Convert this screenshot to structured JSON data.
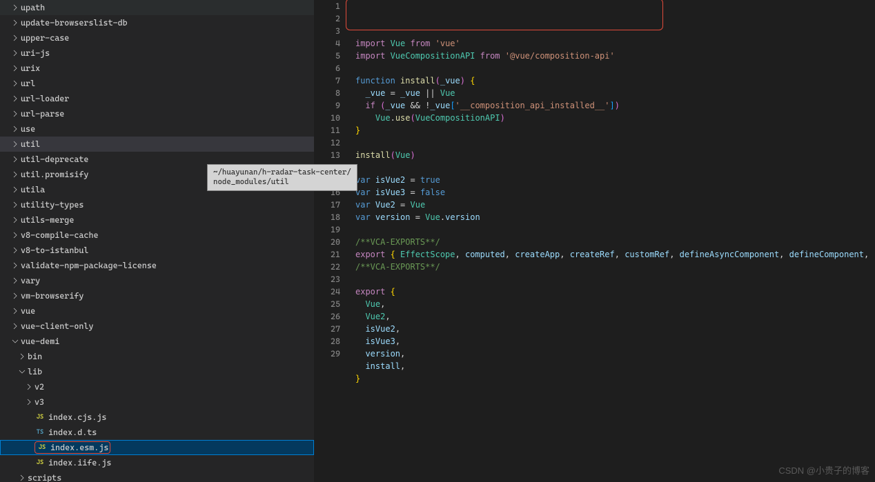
{
  "watermark": "CSDN @小贵子的博客",
  "tooltip": "~/huayunan/h-radar-task-center/\nnode_modules/util",
  "tree": [
    {
      "label": "upath",
      "type": "folder",
      "indent": 1
    },
    {
      "label": "update-browserslist-db",
      "type": "folder",
      "indent": 1
    },
    {
      "label": "upper-case",
      "type": "folder",
      "indent": 1
    },
    {
      "label": "uri-js",
      "type": "folder",
      "indent": 1
    },
    {
      "label": "urix",
      "type": "folder",
      "indent": 1
    },
    {
      "label": "url",
      "type": "folder",
      "indent": 1
    },
    {
      "label": "url-loader",
      "type": "folder",
      "indent": 1
    },
    {
      "label": "url-parse",
      "type": "folder",
      "indent": 1
    },
    {
      "label": "use",
      "type": "folder",
      "indent": 1
    },
    {
      "label": "util",
      "type": "folder",
      "indent": 1,
      "hover": true
    },
    {
      "label": "util-deprecate",
      "type": "folder",
      "indent": 1
    },
    {
      "label": "util.promisify",
      "type": "folder",
      "indent": 1
    },
    {
      "label": "utila",
      "type": "folder",
      "indent": 1
    },
    {
      "label": "utility-types",
      "type": "folder",
      "indent": 1
    },
    {
      "label": "utils-merge",
      "type": "folder",
      "indent": 1
    },
    {
      "label": "v8-compile-cache",
      "type": "folder",
      "indent": 1
    },
    {
      "label": "v8-to-istanbul",
      "type": "folder",
      "indent": 1
    },
    {
      "label": "validate-npm-package-license",
      "type": "folder",
      "indent": 1
    },
    {
      "label": "vary",
      "type": "folder",
      "indent": 1
    },
    {
      "label": "vm-browserify",
      "type": "folder",
      "indent": 1
    },
    {
      "label": "vue",
      "type": "folder",
      "indent": 1
    },
    {
      "label": "vue-client-only",
      "type": "folder",
      "indent": 1
    },
    {
      "label": "vue-demi",
      "type": "folder",
      "indent": 1,
      "expanded": true
    },
    {
      "label": "bin",
      "type": "folder",
      "indent": 2
    },
    {
      "label": "lib",
      "type": "folder",
      "indent": 2,
      "expanded": true
    },
    {
      "label": "v2",
      "type": "folder",
      "indent": 3
    },
    {
      "label": "v3",
      "type": "folder",
      "indent": 3
    },
    {
      "label": "index.cjs.js",
      "type": "file",
      "icon": "JS",
      "indent": 3
    },
    {
      "label": "index.d.ts",
      "type": "file",
      "icon": "TS",
      "indent": 3
    },
    {
      "label": "index.esm.js",
      "type": "file",
      "icon": "JS",
      "indent": 3,
      "selected": true,
      "boxed": true
    },
    {
      "label": "index.iife.js",
      "type": "file",
      "icon": "JS",
      "indent": 3
    },
    {
      "label": "scripts",
      "type": "folder",
      "indent": 2
    }
  ],
  "code": {
    "lines": [
      {
        "n": 1,
        "tokens": [
          [
            "import ",
            "kw"
          ],
          [
            "Vue",
            "cls"
          ],
          [
            " from ",
            "kw"
          ],
          [
            "'vue'",
            "str"
          ]
        ]
      },
      {
        "n": 2,
        "tokens": [
          [
            "import ",
            "kw"
          ],
          [
            "VueCompositionAPI",
            "cls"
          ],
          [
            " from ",
            "kw"
          ],
          [
            "'@vue/composition-api'",
            "str"
          ]
        ]
      },
      {
        "n": 3,
        "tokens": [
          [
            "",
            ""
          ]
        ]
      },
      {
        "n": 4,
        "tokens": [
          [
            "function ",
            "const"
          ],
          [
            "install",
            "fn"
          ],
          [
            "(",
            "paren"
          ],
          [
            "_vue",
            "param"
          ],
          [
            ") ",
            "paren"
          ],
          [
            "{",
            "brace"
          ]
        ]
      },
      {
        "n": 5,
        "tokens": [
          [
            "  ",
            ""
          ],
          [
            "_vue",
            "var"
          ],
          [
            " = ",
            ""
          ],
          [
            "_vue",
            "var"
          ],
          [
            " || ",
            ""
          ],
          [
            "Vue",
            "cls"
          ]
        ]
      },
      {
        "n": 6,
        "tokens": [
          [
            "  ",
            ""
          ],
          [
            "if ",
            "kw"
          ],
          [
            "(",
            "paren"
          ],
          [
            "_vue",
            "var"
          ],
          [
            " && !",
            ""
          ],
          [
            "_vue",
            "var"
          ],
          [
            "[",
            "bracket"
          ],
          [
            "'__composition_api_installed__'",
            "str"
          ],
          [
            "]",
            "bracket"
          ],
          [
            ")",
            "paren"
          ]
        ]
      },
      {
        "n": 7,
        "tokens": [
          [
            "    ",
            ""
          ],
          [
            "Vue",
            "cls"
          ],
          [
            ".",
            ""
          ],
          [
            "use",
            "fn"
          ],
          [
            "(",
            "paren"
          ],
          [
            "VueCompositionAPI",
            "cls"
          ],
          [
            ")",
            "paren"
          ]
        ]
      },
      {
        "n": 8,
        "tokens": [
          [
            "}",
            "brace"
          ]
        ]
      },
      {
        "n": 9,
        "tokens": [
          [
            "",
            ""
          ]
        ]
      },
      {
        "n": 10,
        "tokens": [
          [
            "install",
            "fn"
          ],
          [
            "(",
            "paren"
          ],
          [
            "Vue",
            "cls"
          ],
          [
            ")",
            "paren"
          ]
        ]
      },
      {
        "n": 11,
        "tokens": [
          [
            "",
            ""
          ]
        ]
      },
      {
        "n": 12,
        "tokens": [
          [
            "var ",
            "const"
          ],
          [
            "isVue2",
            "var"
          ],
          [
            " = ",
            ""
          ],
          [
            "true",
            "const"
          ]
        ]
      },
      {
        "n": 13,
        "tokens": [
          [
            "var ",
            "const"
          ],
          [
            "isVue3",
            "var"
          ],
          [
            " = ",
            ""
          ],
          [
            "false",
            "const"
          ]
        ]
      },
      {
        "n": 14,
        "tokens": [
          [
            "var ",
            "const"
          ],
          [
            "Vue2",
            "var"
          ],
          [
            " = ",
            ""
          ],
          [
            "Vue",
            "cls"
          ]
        ]
      },
      {
        "n": 15,
        "tokens": [
          [
            "var ",
            "const"
          ],
          [
            "version",
            "var"
          ],
          [
            " = ",
            ""
          ],
          [
            "Vue",
            "cls"
          ],
          [
            ".",
            ""
          ],
          [
            "version",
            "prop"
          ]
        ]
      },
      {
        "n": 16,
        "tokens": [
          [
            "",
            ""
          ]
        ]
      },
      {
        "n": 17,
        "tokens": [
          [
            "/**VCA-EXPORTS**/",
            "comment"
          ]
        ]
      },
      {
        "n": 18,
        "tokens": [
          [
            "export ",
            "kw"
          ],
          [
            "{ ",
            "brace"
          ],
          [
            "EffectScope",
            "cls"
          ],
          [
            ", ",
            ""
          ],
          [
            "computed",
            "var"
          ],
          [
            ", ",
            ""
          ],
          [
            "createApp",
            "var"
          ],
          [
            ", ",
            ""
          ],
          [
            "createRef",
            "var"
          ],
          [
            ", ",
            ""
          ],
          [
            "customRef",
            "var"
          ],
          [
            ", ",
            ""
          ],
          [
            "defineAsyncComponent",
            "var"
          ],
          [
            ", ",
            ""
          ],
          [
            "defineComponent",
            "var"
          ],
          [
            ",",
            ""
          ]
        ]
      },
      {
        "n": 19,
        "tokens": [
          [
            "/**VCA-EXPORTS**/",
            "comment"
          ]
        ]
      },
      {
        "n": 20,
        "tokens": [
          [
            "",
            ""
          ]
        ]
      },
      {
        "n": 21,
        "tokens": [
          [
            "export ",
            "kw"
          ],
          [
            "{",
            "brace"
          ]
        ]
      },
      {
        "n": 22,
        "tokens": [
          [
            "  ",
            ""
          ],
          [
            "Vue",
            "cls"
          ],
          [
            ",",
            ""
          ]
        ]
      },
      {
        "n": 23,
        "tokens": [
          [
            "  ",
            ""
          ],
          [
            "Vue2",
            "cls"
          ],
          [
            ",",
            ""
          ]
        ]
      },
      {
        "n": 24,
        "tokens": [
          [
            "  ",
            ""
          ],
          [
            "isVue2",
            "var"
          ],
          [
            ",",
            ""
          ]
        ]
      },
      {
        "n": 25,
        "tokens": [
          [
            "  ",
            ""
          ],
          [
            "isVue3",
            "var"
          ],
          [
            ",",
            ""
          ]
        ]
      },
      {
        "n": 26,
        "tokens": [
          [
            "  ",
            ""
          ],
          [
            "version",
            "var"
          ],
          [
            ",",
            ""
          ]
        ]
      },
      {
        "n": 27,
        "tokens": [
          [
            "  ",
            ""
          ],
          [
            "install",
            "var"
          ],
          [
            ",",
            ""
          ]
        ]
      },
      {
        "n": 28,
        "tokens": [
          [
            "}",
            "brace"
          ]
        ]
      },
      {
        "n": 29,
        "tokens": [
          [
            "",
            ""
          ]
        ]
      }
    ]
  }
}
